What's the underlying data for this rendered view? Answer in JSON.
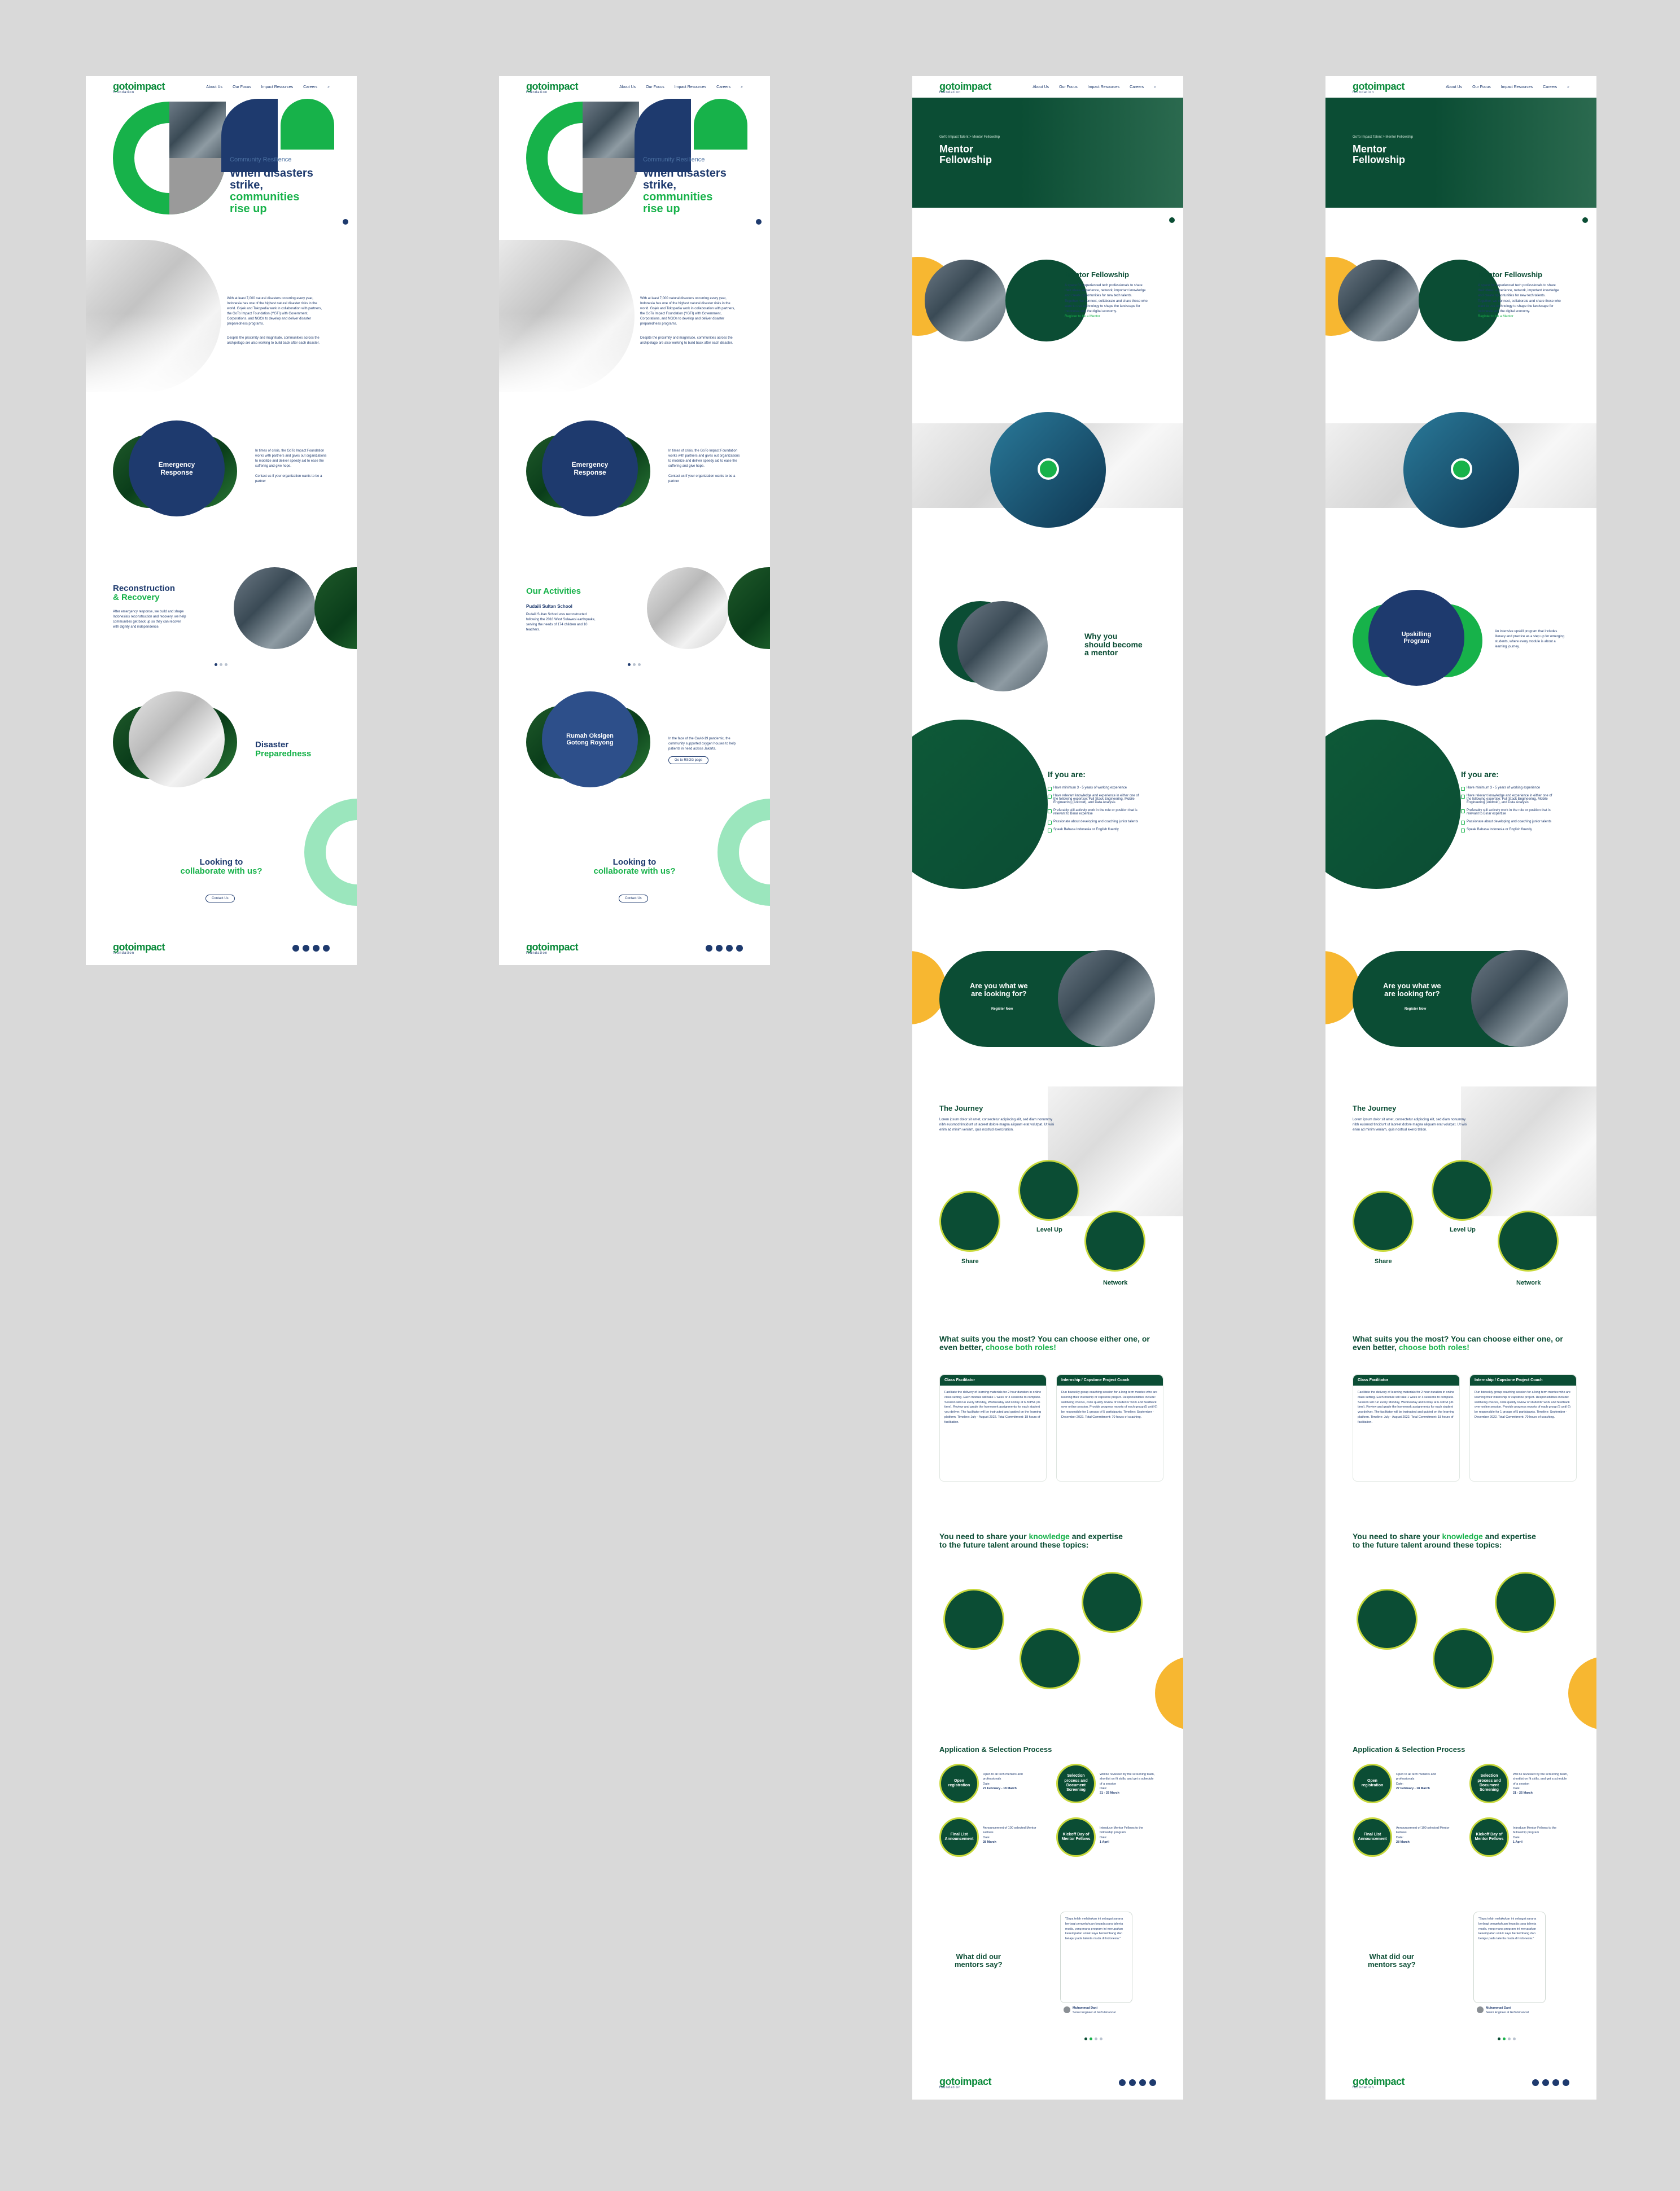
{
  "nav": {
    "logo": "gotoimpact",
    "logo_sub": "foundation",
    "menu": [
      "About Us",
      "Our Focus",
      "Impact Resources",
      "Careers",
      "Contact"
    ]
  },
  "page1": {
    "hero_kicker": "Community Resilience",
    "hero_title_a": "When disasters",
    "hero_title_b": "strike,",
    "hero_title_c": "communities",
    "hero_title_d": "rise up",
    "intro_p1": "With at least 7,000 natural disasters occurring every year, Indonesia has one of the highest natural disaster risks in the world. Gojek and Tokopedia work in collaboration with partners, the GoTo Impact Foundation (YGTI) with Government, Corporations, and NGOs to develop and deliver disaster preparedness programs.",
    "intro_p2": "Despite the proximity and magnitude, communities across the archipelago are also working to build back after each disaster.",
    "emergency_label": "Emergency Response",
    "emergency_text": "In times of crisis, the GoTo Impact Foundation works with partners and gives out organizations to mobilize and deliver speedy aid to ease the suffering and give hope.",
    "emergency_link": "Contact us if your organization wants to be a partner",
    "reco_title_a": "Reconstruction",
    "reco_title_b": "& Recovery",
    "reco_text": "After emergency response, we build and shape Indonesia's reconstruction and recovery, we help communities get back up so they can recover with dignity and independence.",
    "prep_title_a": "Disaster",
    "prep_title_b": "Preparedness",
    "cta_a": "Looking to",
    "cta_b": "collaborate with us?",
    "cta_btn": "Contact Us"
  },
  "page2": {
    "activities_title": "Our Activities",
    "activity_name": "Pudaili Sultan School",
    "activity_text": "Pudaili Sultan School was reconstructed following the 2018 West Sulawesi earthquake, serving the needs of 174 children and 10 teachers.",
    "oxygen_label_a": "Rumah Oksigen",
    "oxygen_label_b": "Gotong Royong",
    "oxygen_text": "In the face of the Covid-19 pandemic, the community supported oxygen houses to help patients in need across Jakarta.",
    "oxygen_btn": "Go to RSOG page"
  },
  "page3": {
    "breadcrumb": "GoTo Impact Talent  >  Mentor Fellowship",
    "hero_title_a": "Mentor",
    "hero_title_b": "Fellowship",
    "intro_title": "Mentor Fellowship",
    "intro_text": "A space for experienced tech professionals to share their ideas, experience, network, important knowledge and create opportunities for new tech talents.",
    "intro_text2": "Together, we connect, collaborate and share those who want to use technology to shape the landscape for Indonesia and the digital economy.",
    "intro_link": "Register to be a Mentor",
    "why_a": "Why you",
    "why_b": "should become",
    "why_c": "a mentor",
    "upskill_label": "Upskilling Program",
    "upskill_text": "An intensive upskill program that includes literacy and practice as a step up for emerging students, where every module is about a learning journey.",
    "if_title": "If you are:",
    "if_items": [
      "Have minimum 3 - 5 years of working experience",
      "Have relevant knowledge and experience in either one of the following expertise: Full Stack Engineering, Mobile Engineering (Android), and Data Analysis",
      "Preferably still actively work in the role or position that is relevant to Binar expertise",
      "Passionate about developing and coaching junior talents",
      "Speak Bahasa Indonesia or English fluently"
    ],
    "cta_a": "Are you what we",
    "cta_b": "are looking for?",
    "cta_btn": "Register Now",
    "journey_title": "The Journey",
    "journey_text": "Lorem ipsum dolor sit amet, consectetur adipiscing elit, sed diam nonummy nibh euismod tincidunt ut laoreet dolore magna aliquam erat volutpat. Ut wisi enim ad minim veniam, quis nostrud exerci tation.",
    "journey_steps": [
      "Share",
      "Level Up",
      "Network"
    ],
    "roles_title_a": "What suits you the most? You can choose either one, or even better,",
    "roles_title_b": "choose both roles!",
    "role1_title": "Class Facilitator",
    "role1_text": "Facilitate the delivery of learning materials for 2 hour duration in online class setting. Each module will take 1 week or 3 sessions to complete. Session will run every Monday, Wednesday and Friday at 6.30PM (JK time). Review and grade the homework assignments for each student you deliver. The facilitator will be instructed and guided on the learning platform. Timeline: July - August 2022. Total Commitment: 18 hours of facilitation.",
    "role2_title": "Internship / Capstone Project Coach",
    "role2_text": "Run biweekly group coaching session for a long term mentee who are learning their internship or capstone project. Responsibilities include: wellbeing checks, code quality review of students' work and feedback over online session. Provide progress reports of each group (5 until 6) be responsible for 1 groups of 5 participants. Timeline: September - December 2022. Total Commitment: 70 hours of coaching.",
    "topics_title_a": "You need to share your",
    "topics_title_b": "knowledge",
    "topics_title_c": "and expertise to the future talent around these topics:",
    "process_title": "Application & Selection Process",
    "process": [
      {
        "name": "Open registration",
        "text": "Open to all tech mentors and professionals",
        "date_label": "Date:",
        "date": "27 February - 18 March"
      },
      {
        "name": "Selection process and Document Screening",
        "text": "Will be reviewed by the screening team, shortlist on fit skills, and get a schedule of a session",
        "date_label": "Date:",
        "date": "21 - 25 March"
      },
      {
        "name": "Final List Announcement",
        "text": "Announcement of 100 selected Mentor Fellows",
        "date_label": "Date:",
        "date": "28 March"
      },
      {
        "name": "Kickoff Day of Mentor Fellows",
        "text": "Introduce Mentor Fellows to the fellowship program",
        "date_label": "Date:",
        "date": "1 April"
      }
    ],
    "testi_title_a": "What did our",
    "testi_title_b": "mentors say?",
    "testi_text": "\"Saya telah melakukan ini sebagai sarana berbagi pengetahuan kepada para talenta muda, yang mana program ini merupakan kesempatan untuk saya berkembang dan belajar pada talenta muda di Indonesia.\"",
    "testi_name": "Muhammad Dani",
    "testi_role": "Senior Engineer at GoTo Financial"
  },
  "page4": {
    "upskill_label_a": "Upskilling",
    "upskill_label_b": "Program"
  },
  "colors": {
    "navy": "#1e3a6e",
    "green": "#17b24a",
    "dark_green": "#0b4d34",
    "yellow": "#f7b731",
    "mint": "#9be6bd"
  },
  "icons": [
    "search-icon",
    "play-icon",
    "arrow-right-icon",
    "facebook-icon",
    "instagram-icon",
    "youtube-icon",
    "linkedin-icon"
  ]
}
